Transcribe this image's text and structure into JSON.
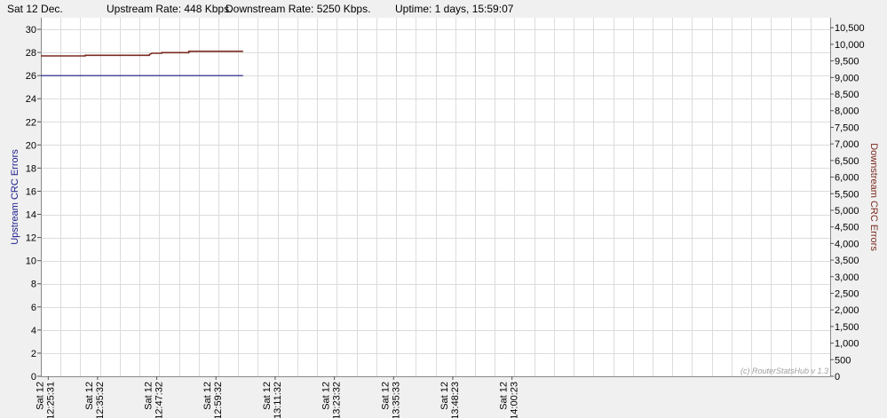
{
  "header": {
    "date": "Sat 12 Dec.",
    "upstream": "Upstream Rate: 448 Kbps.",
    "downstream": "Downstream Rate: 5250 Kbps.",
    "uptime": "Uptime: 1 days, 15:59:07"
  },
  "watermark": "(c) RouterStatsHub v 1.3",
  "colors": {
    "upstream": "#1c1c8c",
    "downstream": "#7b2a20",
    "grid": "#dcdcdc",
    "plot_bg": "#ffffff",
    "axis": "#888888"
  },
  "chart_data": {
    "type": "line",
    "title": "",
    "xlabel": "",
    "ylabel_left": "Upstream CRC Errors",
    "ylabel_right": "Downstream CRC Errors",
    "ylim_left": [
      0,
      31
    ],
    "ylim_right": [
      0,
      10800
    ],
    "yticks_left": [
      0,
      2,
      4,
      6,
      8,
      10,
      12,
      14,
      16,
      18,
      20,
      22,
      24,
      26,
      28,
      30
    ],
    "yticks_right": [
      "0",
      "500",
      "1,000",
      "1,500",
      "2,000",
      "2,500",
      "3,000",
      "3,500",
      "4,000",
      "4,500",
      "5,000",
      "5,500",
      "6,000",
      "6,500",
      "7,000",
      "7,500",
      "8,000",
      "8,500",
      "9,000",
      "9,500",
      "10,000",
      "10,500"
    ],
    "x_labels": [
      [
        "Sat 12",
        "12:25:31"
      ],
      [
        "Sat 12",
        "12:35:32"
      ],
      [
        "Sat 12",
        "12:47:32"
      ],
      [
        "Sat 12",
        "12:59:32"
      ],
      [
        "Sat 12",
        "13:11:32"
      ],
      [
        "Sat 12",
        "13:23:32"
      ],
      [
        "Sat 12",
        "13:35:33"
      ],
      [
        "Sat 12",
        "13:48:23"
      ],
      [
        "Sat 12",
        "14:00:23"
      ]
    ],
    "x_range_minutes": [
      0,
      160
    ],
    "series": [
      {
        "name": "Upstream CRC Errors",
        "axis": "left",
        "points": [
          [
            0,
            26
          ],
          [
            41,
            26
          ]
        ]
      },
      {
        "name": "Downstream CRC Errors",
        "axis": "right",
        "points": [
          [
            0,
            9650
          ],
          [
            9,
            9650
          ],
          [
            9,
            9670
          ],
          [
            22,
            9670
          ],
          [
            22,
            9690
          ],
          [
            22.5,
            9730
          ],
          [
            24.5,
            9730
          ],
          [
            24.5,
            9750
          ],
          [
            30,
            9750
          ],
          [
            30,
            9790
          ],
          [
            41,
            9790
          ]
        ]
      }
    ]
  }
}
